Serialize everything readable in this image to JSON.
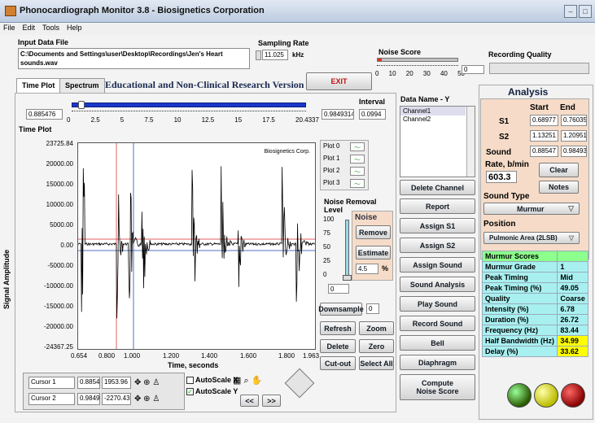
{
  "window": {
    "title": "Phonocardiograph Monitor 3.8 - Biosignetics Corporation",
    "min": "–",
    "max": "□"
  },
  "menu": [
    "File",
    "Edit",
    "Tools",
    "Help"
  ],
  "input": {
    "label": "Input Data File",
    "path_line1": "C:\\Documents and Settings\\user\\Desktop\\Recordings\\Jen's Heart",
    "path_line2": "sounds.wav"
  },
  "sampling": {
    "label": "Sampling Rate",
    "value": "11.025",
    "unit": "kHz"
  },
  "noise_score": {
    "label": "Noise Score",
    "value": "0",
    "ticks": [
      "0",
      "10",
      "20",
      "30",
      "40",
      "50"
    ],
    "level": 0.05
  },
  "recording_quality": {
    "label": "Recording Quality"
  },
  "tabs": {
    "time": "Time Plot",
    "spectrum": "Spectrum"
  },
  "banner": "Educational and Non-Clinical Research Version",
  "exit": "EXIT",
  "slider": {
    "value": "0.885476",
    "ticks": [
      "0",
      "2.5",
      "5",
      "7.5",
      "10",
      "12.5",
      "15",
      "17.5",
      "20.4337"
    ],
    "position": 0.04
  },
  "interval": {
    "label": "Interval",
    "start": "0.9849314",
    "width": "0.0994"
  },
  "time_plot": {
    "title": "Time Plot",
    "watermark": "Biosignetics Corp.",
    "ylabel": "Signal Amplitude",
    "xlabel": "Time, seconds",
    "yticks": [
      "23725.84",
      "20000.00",
      "15000.00",
      "10000.00",
      "5000.00",
      "0.00",
      "-5000.00",
      "-10000.00",
      "-15000.00",
      "-20000.00",
      "-24367.25"
    ],
    "xticks": [
      "0.654",
      "0.800",
      "1.000",
      "1.200",
      "1.400",
      "1.600",
      "1.800",
      "1.963"
    ]
  },
  "plots": [
    "Plot 0",
    "Plot 1",
    "Plot 2",
    "Plot 3"
  ],
  "noise_removal": {
    "label": "Noise Removal",
    "label2": "Level",
    "box_title": "Noise",
    "remove": "Remove",
    "estimate": "Estimate",
    "percent": "4.5",
    "pct": "%",
    "ticks": [
      "100",
      "75",
      "50",
      "25",
      "0"
    ],
    "level_value": "0"
  },
  "downsample": {
    "label": "Downsample",
    "value": "0"
  },
  "buttons": {
    "refresh": "Refresh",
    "zoom": "Zoom",
    "delete": "Delete",
    "zero": "Zero",
    "cutout": "Cut-out",
    "select_all": "Select All"
  },
  "cursors": [
    {
      "name": "Cursor 1",
      "x": "0.88547",
      "y": "1953.96"
    },
    {
      "name": "Cursor 2",
      "x": "0.98493",
      "y": "-2270.43"
    }
  ],
  "autoscale": {
    "x": "AutoScale X",
    "y": "AutoScale Y",
    "x_checked": false,
    "y_checked": true
  },
  "nav": {
    "prev": "<<",
    "next": ">>"
  },
  "data_name": {
    "label": "Data Name - Y",
    "items": [
      "Channel1",
      "Channel2"
    ]
  },
  "actions": [
    "Delete Channel",
    "Report",
    "Assign S1",
    "Assign S2",
    "Assign Sound",
    "Sound Analysis",
    "Play Sound",
    "Record Sound",
    "Bell",
    "Diaphragm"
  ],
  "compute": {
    "line1": "Compute",
    "line2": "Noise Score"
  },
  "analysis": {
    "title": "Analysis",
    "start": "Start",
    "end": "End",
    "rows": [
      {
        "label": "S1",
        "start": "0.68977",
        "end": "0.76035"
      },
      {
        "label": "S2",
        "start": "1.13251",
        "end": "1.20951"
      },
      {
        "label": "Sound",
        "start": "0.88547",
        "end": "0.98493"
      }
    ],
    "rate_label": "Rate, b/min",
    "rate": "603.3",
    "clear": "Clear",
    "notes": "Notes",
    "sound_type_label": "Sound Type",
    "sound_type": "Murmur",
    "position_label": "Position",
    "position": "Pulmonic Area (2LSB)"
  },
  "scores": [
    [
      "Murmur Scores",
      ""
    ],
    [
      "Murmur Grade",
      "1"
    ],
    [
      "Peak Timing",
      "Mid"
    ],
    [
      "Peak Timing (%)",
      "49.05"
    ],
    [
      "Quality",
      "Coarse"
    ],
    [
      "Intensity (%)",
      "6.78"
    ],
    [
      "Duration (%)",
      "26.72"
    ],
    [
      "Frequency (Hz)",
      "83.44"
    ],
    [
      "Half Bandwidth (Hz)",
      "34.99"
    ],
    [
      "Delay (%)",
      "33.62"
    ]
  ],
  "colors": {
    "accent": "#0040c0",
    "panel": "#f6dcc8",
    "score_bg": "#a8f0f0",
    "highlight": "#ffff00",
    "value_green": "#8cff8c"
  }
}
